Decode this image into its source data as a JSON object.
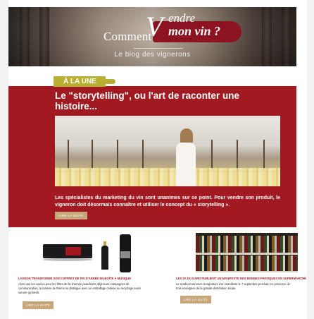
{
  "header": {
    "logo": {
      "word_comment": "Comment",
      "word_v": "V",
      "word_vendre": "endre",
      "word_mon_vin": "mon vin ?"
    },
    "tagline": "Le blog des vignerons"
  },
  "featured": {
    "section_label": "À LA UNE",
    "title": "Le \"storytelling\", ou l'art de raconter une histoire...",
    "description": "Les spécialistes du marketing du vin sont unanimes sur ce point. Pour vendre son produit, le vigneron doit désormais connaître et utiliser le concept du « storytelling ».",
    "button_label": "LIRE LA SUITE"
  },
  "cards": [
    {
      "title": "LANSON TRANSFORME SON COFFRET DE FIN D'ANNÉE EN BOÎTE À MUSIQUE",
      "text": "Alors que les cuvées pour les fêtes de fin d'année peaufinent déjà leurs campagnes de communication, la maison de Reims se distingue avec un emballage cadeau au recyclage aussi sonore qu'inédit.",
      "box_brand": "LANSON",
      "button_label": "LIRE LA SUITE"
    },
    {
      "title": "LES 3A DU GARD PUBLIENT UN MANIFESTE DES BONNES PRATIQUES EN SUPERMARCHÉ",
      "text": "Le syndicat annonce la signature d'un manifeste le 7 septembre prochain en présence de trois enseignes de la grande-distribution locale.",
      "button_label": "LIRE LA SUITE"
    }
  ],
  "colors": {
    "brand_red": "#a11a22",
    "label_olive": "#b8b032",
    "button_tan": "#c7a779"
  }
}
